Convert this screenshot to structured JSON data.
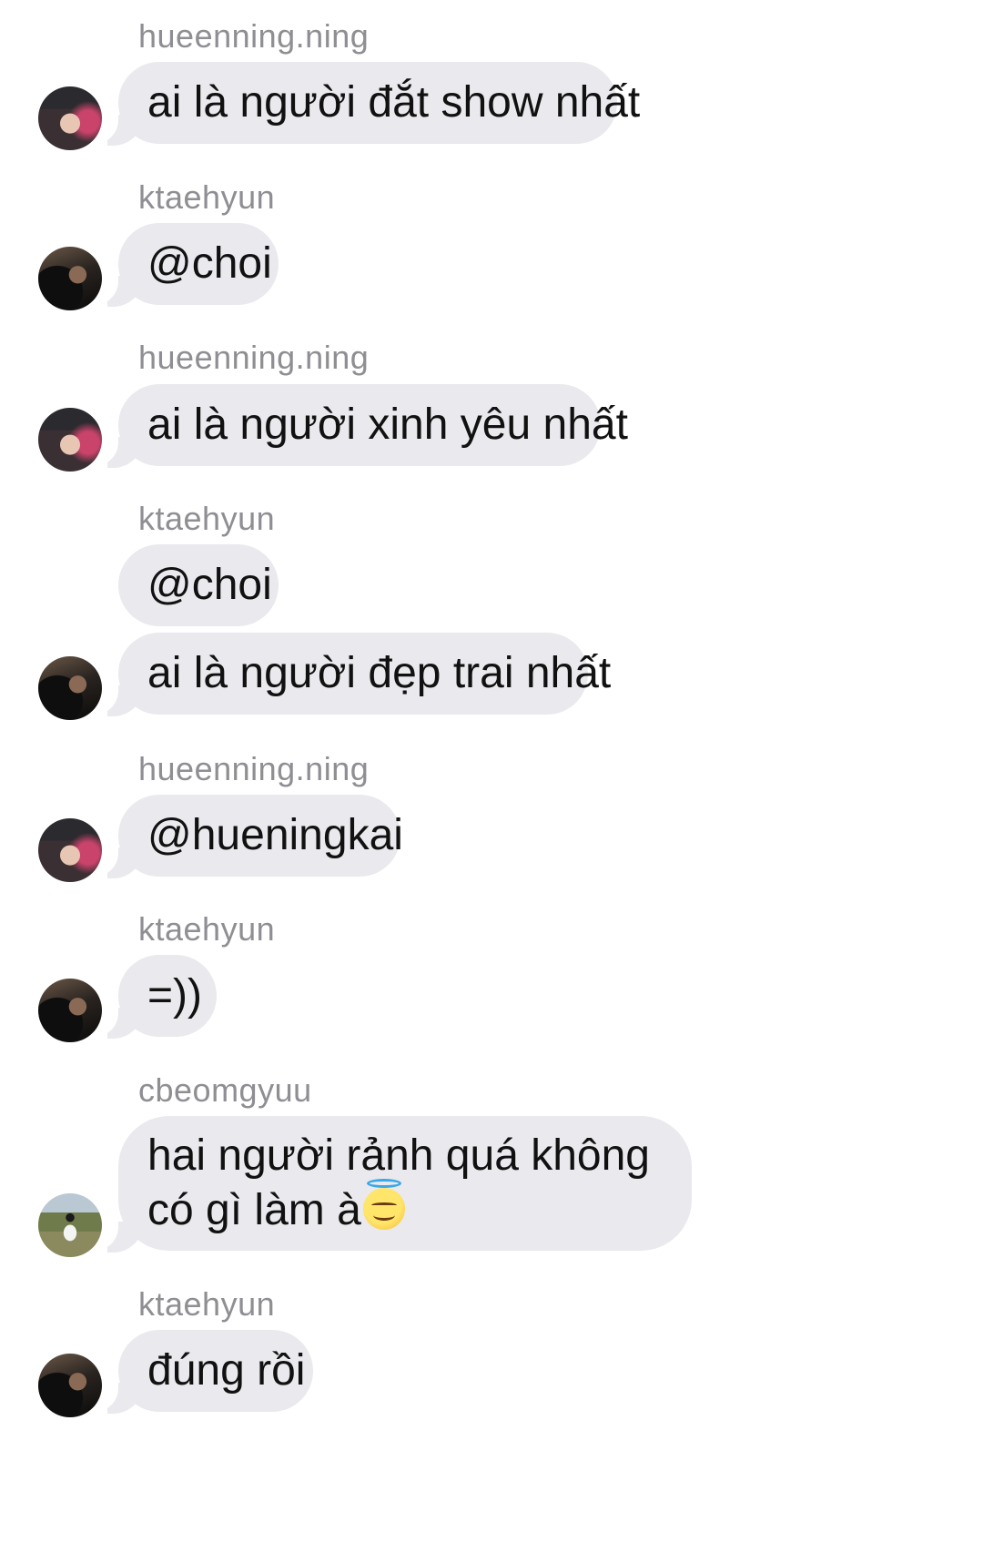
{
  "messages": [
    {
      "sender": "hueenning.ning",
      "text": "ai là người đắt show nhất"
    },
    {
      "sender": "ktaehyun",
      "text": "@choi"
    },
    {
      "sender": "hueenning.ning",
      "text": "ai là người xinh yêu nhất"
    },
    {
      "sender": "ktaehyun",
      "text": "@choi"
    },
    {
      "sender": "",
      "text": "ai là người đẹp trai nhất"
    },
    {
      "sender": "hueenning.ning",
      "text": "@hueningkai"
    },
    {
      "sender": "ktaehyun",
      "text": "=))"
    },
    {
      "sender": "cbeomgyuu",
      "text": "hai người rảnh quá không có gì làm à",
      "emoji": "smiling-face-with-halo"
    },
    {
      "sender": "ktaehyun",
      "text": "đúng rồi"
    }
  ],
  "colors": {
    "bubble": "#e9e9ee",
    "sender_text": "#8e8e93",
    "message_text": "#111111",
    "background": "#ffffff"
  }
}
